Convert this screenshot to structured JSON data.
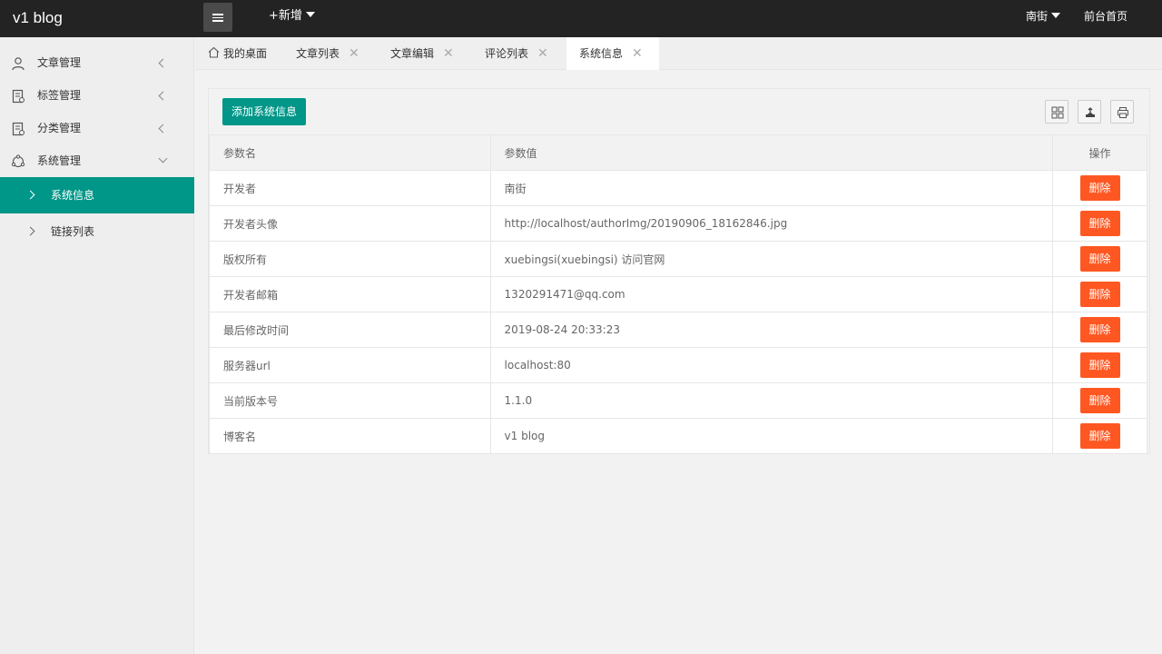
{
  "header": {
    "logo": "v1 blog",
    "add_label": "+新增",
    "user_label": "南街",
    "front_label": "前台首页"
  },
  "sidebar": {
    "items": [
      {
        "label": "文章管理",
        "icon": "user-icon"
      },
      {
        "label": "标签管理",
        "icon": "document-icon"
      },
      {
        "label": "分类管理",
        "icon": "document-icon"
      },
      {
        "label": "系统管理",
        "icon": "cluster-icon"
      }
    ],
    "sub_items": [
      {
        "label": "系统信息",
        "active": true
      },
      {
        "label": "链接列表",
        "active": false
      }
    ]
  },
  "tabs": [
    {
      "label": "我的桌面"
    },
    {
      "label": "文章列表"
    },
    {
      "label": "文章编辑"
    },
    {
      "label": "评论列表"
    },
    {
      "label": "系统信息"
    }
  ],
  "toolbar": {
    "add_button": "添加系统信息",
    "icons": [
      "columns-icon",
      "export-icon",
      "print-icon"
    ]
  },
  "table": {
    "headers": [
      "参数名",
      "参数值",
      "操作"
    ],
    "delete_label": "删除",
    "rows": [
      {
        "name": "开发者",
        "value": "南街"
      },
      {
        "name": "开发者头像",
        "value": "http://localhost/authorImg/20190906_18162846.jpg"
      },
      {
        "name": "版权所有",
        "value": "xuebingsi(xuebingsi) 访问官网"
      },
      {
        "name": "开发者邮箱",
        "value": "1320291471@qq.com"
      },
      {
        "name": "最后修改时间",
        "value": "2019-08-24 20:33:23"
      },
      {
        "name": "服务器url",
        "value": "localhost:80"
      },
      {
        "name": "当前版本号",
        "value": "1.1.0"
      },
      {
        "name": "博客名",
        "value": "v1 blog"
      }
    ]
  },
  "colors": {
    "header_bg": "#232323",
    "accent": "#009688",
    "danger": "#ff5722"
  }
}
